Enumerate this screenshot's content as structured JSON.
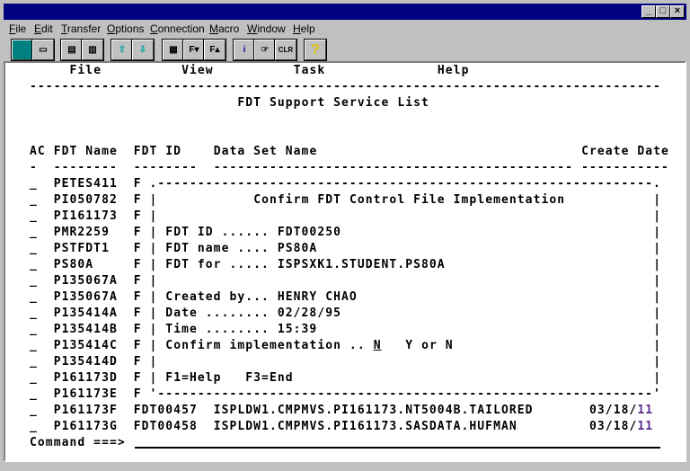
{
  "window": {
    "controls": [
      "minimize",
      "maximize",
      "close"
    ]
  },
  "menubar": [
    "File",
    "Edit",
    "Transfer",
    "Options",
    "Connection",
    "Macro",
    "Window",
    "Help"
  ],
  "toolbar": [
    {
      "icon": "display-icon"
    },
    {
      "icon": "print-icon"
    },
    {
      "icon": "copy-icon"
    },
    {
      "icon": "paste-icon"
    },
    {
      "icon": "send-file-icon"
    },
    {
      "icon": "receive-file-icon"
    },
    {
      "icon": "color-map-icon"
    },
    {
      "icon": "font-down-icon",
      "label": "F▾"
    },
    {
      "icon": "font-up-icon",
      "label": "F▴"
    },
    {
      "icon": "info-icon",
      "label": "i"
    },
    {
      "icon": "pointer-hand-icon",
      "label": "☞"
    },
    {
      "icon": "clear-icon",
      "label": "CLR"
    },
    {
      "icon": "help-icon",
      "label": "?"
    }
  ],
  "terminal": {
    "actions": [
      "File",
      "View",
      "Task",
      "Help"
    ],
    "separator": "-------------------------------------------------------------------------------",
    "title": "FDT Support Service List",
    "headers": {
      "ac": "AC",
      "name": "FDT Name",
      "id": "FDT ID",
      "dsn": "Data Set Name",
      "date": "Create Date"
    },
    "header_dashes": {
      "ac": "-",
      "name": "--------",
      "id": "--------",
      "dsn": "---------------------------------------------",
      "date": "-----------"
    },
    "rows": [
      {
        "ac": "_",
        "name": "PETES411",
        "id": "F"
      },
      {
        "ac": "_",
        "name": "PI050782",
        "id": "F"
      },
      {
        "ac": "_",
        "name": "PI161173",
        "id": "F"
      },
      {
        "ac": "_",
        "name": "PMR2259",
        "id": "F"
      },
      {
        "ac": "_",
        "name": "PSTFDT1",
        "id": "F"
      },
      {
        "ac": "_",
        "name": "PS80A",
        "id": "F"
      },
      {
        "ac": "_",
        "name": "P135067A",
        "id": "F"
      },
      {
        "ac": "_",
        "name": "P135067A",
        "id": "F"
      },
      {
        "ac": "_",
        "name": "P135414A",
        "id": "F"
      },
      {
        "ac": "_",
        "name": "P135414B",
        "id": "F"
      },
      {
        "ac": "_",
        "name": "P135414C",
        "id": "F"
      },
      {
        "ac": "_",
        "name": "P135414D",
        "id": "F"
      },
      {
        "ac": "_",
        "name": "P161173D",
        "id": "F"
      },
      {
        "ac": "_",
        "name": "P161173E",
        "id": "F"
      },
      {
        "ac": "_",
        "name": "P161173F",
        "id": "FDT00457",
        "dsn": "ISPLDW1.CMPMVS.PI161173.NT5004B.TAILORED",
        "date": "03/18/",
        "date_yr": "11"
      },
      {
        "ac": "_",
        "name": "P161173G",
        "id": "FDT00458",
        "dsn": "ISPLDW1.CMPMVS.PI161173.SASDATA.HUFMAN",
        "date": "03/18/",
        "date_yr": "11"
      }
    ],
    "popup": {
      "top_border": ".--------------------------------------------------------------.",
      "bottom_border": "'--------------------------------------------------------------'",
      "title": "Confirm FDT Control File Implementation",
      "fdt_id": "FDT ID ...... FDT00250",
      "fdt_name": "FDT name .... PS80A",
      "fdt_for": "FDT for ..... ISPSXK1.STUDENT.PS80A",
      "created_by": "Created by... HENRY CHAO",
      "date": "Date ........ 02/28/95",
      "time": "Time ........ 15:39",
      "confirm_label": "Confirm implementation ..",
      "confirm_value": "N",
      "confirm_hint": "Y or N",
      "keys": "F1=Help   F3=End"
    },
    "command_label": "Command ===>"
  }
}
